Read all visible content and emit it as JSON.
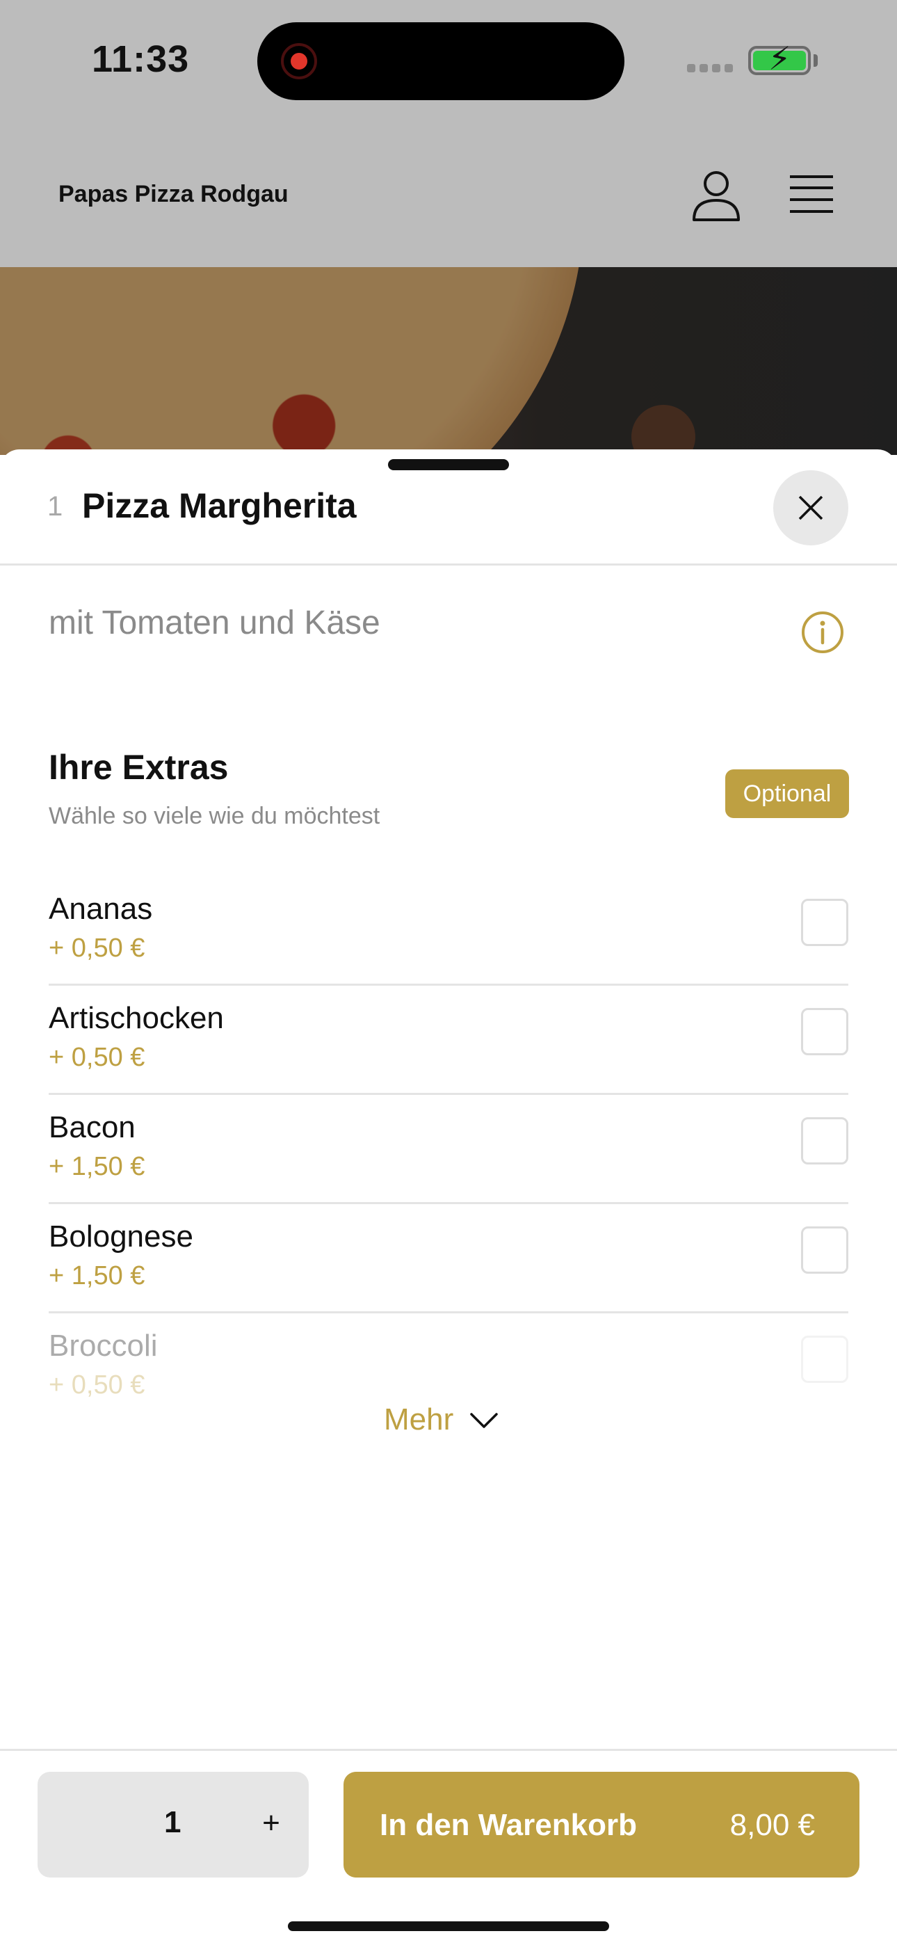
{
  "status_bar": {
    "time": "11:33"
  },
  "header": {
    "restaurant_name": "Papas Pizza Rodgau",
    "icons": [
      "user-icon",
      "hamburger-menu-icon"
    ]
  },
  "item": {
    "number": "1",
    "title": "Pizza Margherita",
    "description": "mit Tomaten und Käse"
  },
  "extras": {
    "title": "Ihre Extras",
    "subtitle": "Wähle so viele wie du möchtest",
    "badge": "Optional",
    "items": [
      {
        "name": "Ananas",
        "price": "+ 0,50 €",
        "checked": false
      },
      {
        "name": "Artischocken",
        "price": "+ 0,50 €",
        "checked": false
      },
      {
        "name": "Bacon",
        "price": "+ 1,50 €",
        "checked": false
      },
      {
        "name": "Bolognese",
        "price": "+ 1,50 €",
        "checked": false
      },
      {
        "name": "Broccoli",
        "price": "+ 0,50 €",
        "checked": false
      }
    ],
    "more_label": "Mehr"
  },
  "footer": {
    "quantity": "1",
    "plus_label": "+",
    "add_to_cart_label": "In den Warenkorb",
    "total_price": "8,00 €"
  },
  "colors": {
    "accent": "#bea042",
    "overlay_header": "#bcbcbc",
    "quantity_box": "#e6e6e6"
  }
}
